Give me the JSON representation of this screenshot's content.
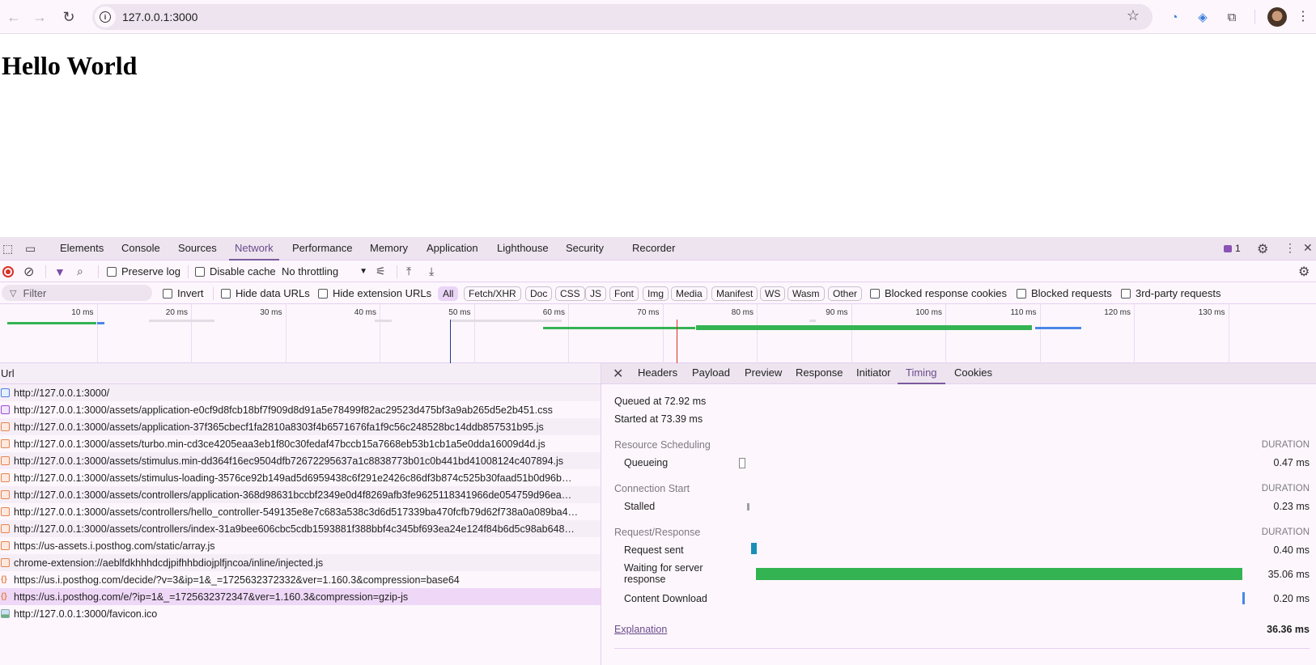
{
  "browser": {
    "url": "127.0.0.1:3000",
    "icons": [
      "back-icon",
      "forward-icon",
      "reload-icon",
      "site-info-icon",
      "bookmark-star-icon",
      "extension-1password-icon",
      "extension-tag-icon",
      "extensions-puzzle-icon",
      "profile-avatar",
      "menu-kebab-icon"
    ]
  },
  "page": {
    "heading": "Hello World"
  },
  "devtools": {
    "tabs": [
      "Elements",
      "Console",
      "Sources",
      "Network",
      "Performance",
      "Memory",
      "Application",
      "Lighthouse",
      "Security",
      "Recorder"
    ],
    "active_tab": "Network",
    "issues_count": "1",
    "toolbar": {
      "preserve_log": "Preserve log",
      "disable_cache": "Disable cache",
      "throttling": "No throttling"
    },
    "filter": {
      "placeholder": "Filter",
      "invert": "Invert",
      "hide_data_urls": "Hide data URLs",
      "hide_extension_urls": "Hide extension URLs",
      "types": [
        "All",
        "Fetch/XHR",
        "Doc",
        "CSS",
        "JS",
        "Font",
        "Img",
        "Media",
        "Manifest",
        "WS",
        "Wasm",
        "Other"
      ],
      "active_type": "All",
      "blocked_response_cookies": "Blocked response cookies",
      "blocked_requests": "Blocked requests",
      "third_party": "3rd-party requests"
    },
    "overview": {
      "ticks": [
        "10 ms",
        "20 ms",
        "30 ms",
        "40 ms",
        "50 ms",
        "60 ms",
        "70 ms",
        "80 ms",
        "90 ms",
        "100 ms",
        "110 ms",
        "120 ms",
        "130 ms"
      ],
      "dom_content_loaded_ms": 47.5,
      "load_ms": 71.5,
      "colors": {
        "waiting": "#34b353",
        "download": "#4a86e8",
        "dcl": "#1a3a8c",
        "load": "#d93025"
      }
    },
    "requests": {
      "header": "Url",
      "rows": [
        {
          "type": "doc",
          "url": "http://127.0.0.1:3000/"
        },
        {
          "type": "css",
          "url": "http://127.0.0.1:3000/assets/application-e0cf9d8fcb18bf7f909d8d91a5e78499f82ac29523d475bf3a9ab265d5e2b451.css"
        },
        {
          "type": "js",
          "url": "http://127.0.0.1:3000/assets/application-37f365cbecf1fa2810a8303f4b6571676fa1f9c56c248528bc14ddb857531b95.js"
        },
        {
          "type": "js",
          "url": "http://127.0.0.1:3000/assets/turbo.min-cd3ce4205eaa3eb1f80c30fedaf47bccb15a7668eb53b1cb1a5e0dda16009d4d.js"
        },
        {
          "type": "js",
          "url": "http://127.0.0.1:3000/assets/stimulus.min-dd364f16ec9504dfb72672295637a1c8838773b01c0b441bd41008124c407894.js"
        },
        {
          "type": "js",
          "url": "http://127.0.0.1:3000/assets/stimulus-loading-3576ce92b149ad5d6959438c6f291e2426c86df3b874c525b30faad51b0d96b…"
        },
        {
          "type": "js",
          "url": "http://127.0.0.1:3000/assets/controllers/application-368d98631bccbf2349e0d4f8269afb3fe9625118341966de054759d96ea…"
        },
        {
          "type": "js",
          "url": "http://127.0.0.1:3000/assets/controllers/hello_controller-549135e8e7c683a538c3d6d517339ba470fcfb79d62f738a0a089ba4…"
        },
        {
          "type": "js",
          "url": "http://127.0.0.1:3000/assets/controllers/index-31a9bee606cbc5cdb1593881f388bbf4c345bf693ea24e124f84b6d5c98ab648…"
        },
        {
          "type": "js",
          "url": "https://us-assets.i.posthog.com/static/array.js"
        },
        {
          "type": "js",
          "url": "chrome-extension://aeblfdkhhhdcdjpifhhbdiojplfjncoa/inline/injected.js"
        },
        {
          "type": "fetch",
          "url": "https://us.i.posthog.com/decide/?v=3&ip=1&_=1725632372332&ver=1.160.3&compression=base64"
        },
        {
          "type": "fetch",
          "url": "https://us.i.posthog.com/e/?ip=1&_=1725632372347&ver=1.160.3&compression=gzip-js",
          "selected": true
        },
        {
          "type": "img",
          "url": "http://127.0.0.1:3000/favicon.ico"
        }
      ]
    },
    "detail": {
      "tabs": [
        "Headers",
        "Payload",
        "Preview",
        "Response",
        "Initiator",
        "Timing",
        "Cookies"
      ],
      "active_tab": "Timing",
      "queued_at": "Queued at 72.92 ms",
      "started_at": "Started at 73.39 ms",
      "duration_label": "DURATION",
      "sections": [
        {
          "title": "Resource Scheduling",
          "phases": [
            {
              "label": "Queueing",
              "value": "0.47 ms"
            }
          ]
        },
        {
          "title": "Connection Start",
          "phases": [
            {
              "label": "Stalled",
              "value": "0.23 ms"
            }
          ]
        },
        {
          "title": "Request/Response",
          "phases": [
            {
              "label": "Request sent",
              "value": "0.40 ms"
            },
            {
              "label": "Waiting for server response",
              "value": "35.06 ms"
            },
            {
              "label": "Content Download",
              "value": "0.20 ms"
            }
          ]
        }
      ],
      "explanation": "Explanation",
      "total": "36.36 ms"
    }
  }
}
